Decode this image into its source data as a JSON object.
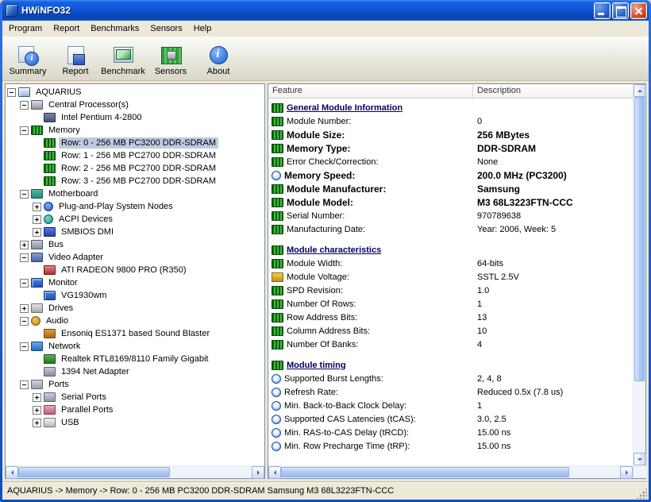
{
  "window": {
    "title": "HWiNFO32"
  },
  "menu": {
    "items": [
      "Program",
      "Report",
      "Benchmarks",
      "Sensors",
      "Help"
    ]
  },
  "toolbar": {
    "buttons": [
      {
        "label": "Summary",
        "icon": "summary-icon"
      },
      {
        "label": "Report",
        "icon": "report-icon"
      },
      {
        "label": "Benchmark",
        "icon": "benchmark-icon"
      },
      {
        "label": "Sensors",
        "icon": "sensors-icon"
      },
      {
        "label": "About",
        "icon": "about-icon"
      }
    ]
  },
  "tree": {
    "items": [
      {
        "label": "AQUARIUS",
        "level": 0,
        "expander": "minus",
        "icon": "computer",
        "selected": false
      },
      {
        "label": "Central Processor(s)",
        "level": 1,
        "expander": "minus",
        "icon": "cpu",
        "selected": false
      },
      {
        "label": "Intel Pentium 4-2800",
        "level": 2,
        "expander": "none",
        "icon": "chip",
        "selected": false
      },
      {
        "label": "Memory",
        "level": 1,
        "expander": "minus",
        "icon": "memory",
        "selected": false
      },
      {
        "label": "Row: 0 - 256 MB PC3200 DDR-SDRAM",
        "level": 2,
        "expander": "none",
        "icon": "ram",
        "selected": true
      },
      {
        "label": "Row: 1 - 256 MB PC2700 DDR-SDRAM",
        "level": 2,
        "expander": "none",
        "icon": "ram",
        "selected": false
      },
      {
        "label": "Row: 2 - 256 MB PC2700 DDR-SDRAM",
        "level": 2,
        "expander": "none",
        "icon": "ram",
        "selected": false
      },
      {
        "label": "Row: 3 - 256 MB PC2700 DDR-SDRAM",
        "level": 2,
        "expander": "none",
        "icon": "ram",
        "selected": false
      },
      {
        "label": "Motherboard",
        "level": 1,
        "expander": "minus",
        "icon": "motherboard",
        "selected": false
      },
      {
        "label": "Plug-and-Play System Nodes",
        "level": 2,
        "expander": "plus",
        "icon": "pnp",
        "selected": false
      },
      {
        "label": "ACPI Devices",
        "level": 2,
        "expander": "plus",
        "icon": "acpi",
        "selected": false
      },
      {
        "label": "SMBIOS DMI",
        "level": 2,
        "expander": "plus",
        "icon": "smbios",
        "selected": false
      },
      {
        "label": "Bus",
        "level": 1,
        "expander": "plus",
        "icon": "bus",
        "selected": false
      },
      {
        "label": "Video Adapter",
        "level": 1,
        "expander": "minus",
        "icon": "video",
        "selected": false
      },
      {
        "label": "ATI RADEON 9800 PRO (R350)",
        "level": 2,
        "expander": "none",
        "icon": "gpu",
        "selected": false
      },
      {
        "label": "Monitor",
        "level": 1,
        "expander": "minus",
        "icon": "monitor",
        "selected": false
      },
      {
        "label": "VG1930wm",
        "level": 2,
        "expander": "none",
        "icon": "display",
        "selected": false
      },
      {
        "label": "Drives",
        "level": 1,
        "expander": "plus",
        "icon": "drives",
        "selected": false
      },
      {
        "label": "Audio",
        "level": 1,
        "expander": "minus",
        "icon": "audio",
        "selected": false
      },
      {
        "label": "Ensoniq ES1371 based Sound Blaster",
        "level": 2,
        "expander": "none",
        "icon": "sound",
        "selected": false
      },
      {
        "label": "Network",
        "level": 1,
        "expander": "minus",
        "icon": "network",
        "selected": false
      },
      {
        "label": "Realtek RTL8169/8110 Family Gigabit",
        "level": 2,
        "expander": "none",
        "icon": "nic",
        "selected": false
      },
      {
        "label": "1394 Net Adapter",
        "level": 2,
        "expander": "none",
        "icon": "nic1394",
        "selected": false
      },
      {
        "label": "Ports",
        "level": 1,
        "expander": "minus",
        "icon": "ports",
        "selected": false
      },
      {
        "label": "Serial Ports",
        "level": 2,
        "expander": "plus",
        "icon": "serial",
        "selected": false
      },
      {
        "label": "Parallel Ports",
        "level": 2,
        "expander": "plus",
        "icon": "parallel",
        "selected": false
      },
      {
        "label": "USB",
        "level": 2,
        "expander": "plus",
        "icon": "usb",
        "selected": false
      }
    ]
  },
  "details": {
    "columns": [
      "Feature",
      "Description"
    ],
    "rows": [
      {
        "type": "section",
        "feature": "General Module Information"
      },
      {
        "type": "item",
        "icon": "ram",
        "feature": "Module Number:",
        "description": "0",
        "bold": false
      },
      {
        "type": "item",
        "icon": "ram",
        "feature": "Module Size:",
        "description": "256 MBytes",
        "bold": true
      },
      {
        "type": "item",
        "icon": "ram",
        "feature": "Memory Type:",
        "description": "DDR-SDRAM",
        "bold": true
      },
      {
        "type": "item",
        "icon": "ram",
        "feature": "Error Check/Correction:",
        "description": "None",
        "bold": false
      },
      {
        "type": "item",
        "icon": "clock",
        "feature": "Memory Speed:",
        "description": "200.0 MHz (PC3200)",
        "bold": true
      },
      {
        "type": "item",
        "icon": "ram",
        "feature": "Module Manufacturer:",
        "description": "Samsung",
        "bold": true
      },
      {
        "type": "item",
        "icon": "ram",
        "feature": "Module Model:",
        "description": "M3 68L3223FTN-CCC",
        "bold": true
      },
      {
        "type": "item",
        "icon": "ram",
        "feature": "Serial Number:",
        "description": "970789638",
        "bold": false
      },
      {
        "type": "item",
        "icon": "ram",
        "feature": "Manufacturing Date:",
        "description": "Year: 2006, Week: 5",
        "bold": false
      },
      {
        "type": "spacer"
      },
      {
        "type": "section",
        "feature": "Module characteristics"
      },
      {
        "type": "item",
        "icon": "ram",
        "feature": "Module Width:",
        "description": "64-bits",
        "bold": false
      },
      {
        "type": "item",
        "icon": "voltage",
        "feature": "Module Voltage:",
        "description": "SSTL 2.5V",
        "bold": false
      },
      {
        "type": "item",
        "icon": "ram",
        "feature": "SPD Revision:",
        "description": "1.0",
        "bold": false
      },
      {
        "type": "item",
        "icon": "ram",
        "feature": "Number Of Rows:",
        "description": "1",
        "bold": false
      },
      {
        "type": "item",
        "icon": "ram",
        "feature": "Row Address Bits:",
        "description": "13",
        "bold": false
      },
      {
        "type": "item",
        "icon": "ram",
        "feature": "Column Address Bits:",
        "description": "10",
        "bold": false
      },
      {
        "type": "item",
        "icon": "ram",
        "feature": "Number Of Banks:",
        "description": "4",
        "bold": false
      },
      {
        "type": "spacer"
      },
      {
        "type": "section",
        "feature": "Module timing"
      },
      {
        "type": "item",
        "icon": "clock",
        "feature": "Supported Burst Lengths:",
        "description": "2, 4, 8",
        "bold": false
      },
      {
        "type": "item",
        "icon": "clock",
        "feature": "Refresh Rate:",
        "description": "Reduced 0.5x (7.8 us)",
        "bold": false
      },
      {
        "type": "item",
        "icon": "clock",
        "feature": "Min. Back-to-Back Clock Delay:",
        "description": "1",
        "bold": false
      },
      {
        "type": "item",
        "icon": "clock",
        "feature": "Supported CAS Latencies (tCAS):",
        "description": "3.0, 2.5",
        "bold": false
      },
      {
        "type": "item",
        "icon": "clock",
        "feature": "Min. RAS-to-CAS Delay (tRCD):",
        "description": "15.00 ns",
        "bold": false
      },
      {
        "type": "item",
        "icon": "clock",
        "feature": "Min. Row Precharge Time (tRP):",
        "description": "15.00 ns",
        "bold": false
      }
    ]
  },
  "statusbar": {
    "text": "AQUARIUS -> Memory -> Row: 0 - 256 MB PC3200 DDR-SDRAM Samsung M3 68L3223FTN-CCC"
  }
}
